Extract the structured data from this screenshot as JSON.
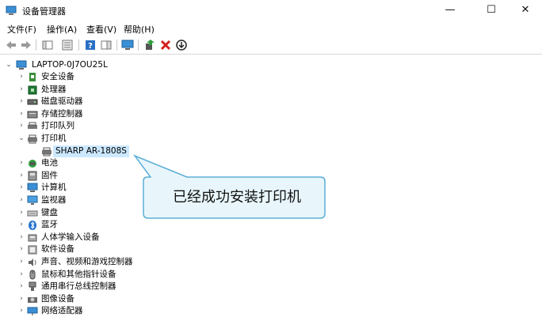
{
  "window": {
    "title": "设备管理器",
    "minimize": "—",
    "maximize": "☐",
    "close": "✕"
  },
  "menu": [
    "文件(F)",
    "操作(A)",
    "查看(V)",
    "帮助(H)"
  ],
  "toolbar_icons": [
    "back-icon",
    "forward-icon",
    "show-hide-tree-icon",
    "properties-icon",
    "help-icon",
    "action-pane-icon",
    "monitor-icon",
    "update-driver-icon",
    "uninstall-icon",
    "disable-icon"
  ],
  "tree": {
    "root": "LAPTOP-0J7OU25L",
    "items": [
      {
        "label": "安全设备",
        "icon": "security-device-icon",
        "expanded": false
      },
      {
        "label": "处理器",
        "icon": "processor-icon",
        "expanded": false
      },
      {
        "label": "磁盘驱动器",
        "icon": "disk-drive-icon",
        "expanded": false
      },
      {
        "label": "存储控制器",
        "icon": "storage-controller-icon",
        "expanded": false
      },
      {
        "label": "打印队列",
        "icon": "print-queue-icon",
        "expanded": false
      },
      {
        "label": "打印机",
        "icon": "printer-icon",
        "expanded": true
      },
      {
        "label": "SHARP AR-1808S",
        "icon": "printer-icon",
        "child": true,
        "selected": true
      },
      {
        "label": "电池",
        "icon": "battery-icon",
        "expanded": false
      },
      {
        "label": "固件",
        "icon": "firmware-icon",
        "expanded": false
      },
      {
        "label": "计算机",
        "icon": "computer-icon",
        "expanded": false
      },
      {
        "label": "监视器",
        "icon": "monitor-icon",
        "expanded": false
      },
      {
        "label": "键盘",
        "icon": "keyboard-icon",
        "expanded": false
      },
      {
        "label": "蓝牙",
        "icon": "bluetooth-icon",
        "expanded": false
      },
      {
        "label": "人体学输入设备",
        "icon": "hid-icon",
        "expanded": false
      },
      {
        "label": "软件设备",
        "icon": "software-device-icon",
        "expanded": false
      },
      {
        "label": "声音、视频和游戏控制器",
        "icon": "sound-icon",
        "expanded": false
      },
      {
        "label": "鼠标和其他指针设备",
        "icon": "mouse-icon",
        "expanded": false
      },
      {
        "label": "通用串行总线控制器",
        "icon": "usb-icon",
        "expanded": false
      },
      {
        "label": "图像设备",
        "icon": "camera-icon",
        "expanded": false
      },
      {
        "label": "网络适配器",
        "icon": "network-adapter-icon",
        "expanded": false
      }
    ]
  },
  "callout": {
    "text": "已经成功安装打印机"
  },
  "colors": {
    "selection": "#cce8ff",
    "callout_fill": "#e8f6fc",
    "callout_border": "#5aaed6"
  }
}
